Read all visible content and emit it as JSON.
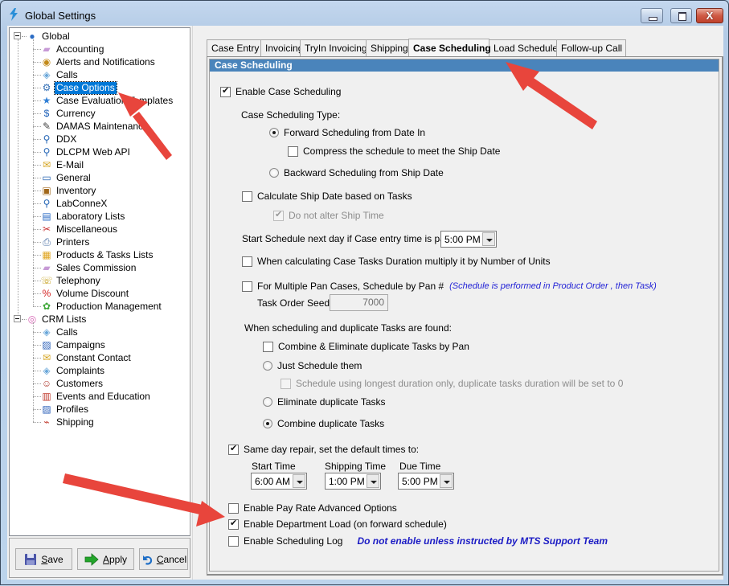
{
  "window": {
    "title": "Global Settings",
    "controls": {
      "minimize": "minimize",
      "maximize": "maximize",
      "close": "X"
    }
  },
  "tree": {
    "groups": [
      {
        "label": "Global",
        "icon": "globe-gear-icon",
        "expanded": true,
        "items": [
          {
            "label": "Accounting",
            "icon": "ticket-icon"
          },
          {
            "label": "Alerts and Notifications",
            "icon": "alarm-clock-icon"
          },
          {
            "label": "Calls",
            "icon": "phone-note-icon"
          },
          {
            "label": "Case Options",
            "icon": "wrench-gear-icon",
            "selected": true
          },
          {
            "label": "Case Evaluation Templates",
            "icon": "star-icon"
          },
          {
            "label": "Currency",
            "icon": "currency-icon"
          },
          {
            "label": "DAMAS Maintenance",
            "icon": "wrench-icon"
          },
          {
            "label": "DDX",
            "icon": "link-icon"
          },
          {
            "label": "DLCPM Web API",
            "icon": "link-icon"
          },
          {
            "label": "E-Mail",
            "icon": "envelope-icon"
          },
          {
            "label": "General",
            "icon": "window-icon"
          },
          {
            "label": "Inventory",
            "icon": "inventory-box-icon"
          },
          {
            "label": "LabConneX",
            "icon": "link-icon"
          },
          {
            "label": "Laboratory Lists",
            "icon": "list-doc-icon"
          },
          {
            "label": "Miscellaneous",
            "icon": "tools-icon"
          },
          {
            "label": "Printers",
            "icon": "printer-icon"
          },
          {
            "label": "Products & Tasks Lists",
            "icon": "blocks-icon"
          },
          {
            "label": "Sales Commission",
            "icon": "ticket-icon"
          },
          {
            "label": "Telephony",
            "icon": "telephone-icon"
          },
          {
            "label": "Volume Discount",
            "icon": "percent-icon"
          },
          {
            "label": "Production Management",
            "icon": "production-icon"
          }
        ]
      },
      {
        "label": "CRM Lists",
        "icon": "disc-icon",
        "expanded": true,
        "items": [
          {
            "label": "Calls",
            "icon": "phone-note-icon"
          },
          {
            "label": "Campaigns",
            "icon": "campaign-icon"
          },
          {
            "label": "Constant Contact",
            "icon": "envelope-icon"
          },
          {
            "label": "Complaints",
            "icon": "phone-note-icon"
          },
          {
            "label": "Customers",
            "icon": "user-icon"
          },
          {
            "label": "Events and Education",
            "icon": "books-icon"
          },
          {
            "label": "Profiles",
            "icon": "campaign-icon"
          },
          {
            "label": "Shipping",
            "icon": "shoe-icon"
          }
        ]
      }
    ]
  },
  "buttons": {
    "save": {
      "label": "Save",
      "mnemonic": "S",
      "rest": "ave"
    },
    "apply": {
      "label": "Apply",
      "mnemonic": "A",
      "rest": "pply"
    },
    "cancel": {
      "label": "Cancel",
      "mnemonic": "C",
      "rest": "ancel"
    }
  },
  "tabs": [
    {
      "label": "Case Entry"
    },
    {
      "label": "Invoicing"
    },
    {
      "label": "TryIn Invoicing"
    },
    {
      "label": "Shipping"
    },
    {
      "label": "Case Scheduling",
      "active": true
    },
    {
      "label": "Load Schedule"
    },
    {
      "label": "Follow-up Call"
    }
  ],
  "page": {
    "section_title": "Case Scheduling",
    "enable_case_scheduling": {
      "label": "Enable Case Scheduling",
      "checked": true
    },
    "scheduling_type_label": "Case Scheduling Type:",
    "forward_scheduling": {
      "label": "Forward Scheduling from Date In",
      "checked": true
    },
    "compress_schedule": {
      "label": "Compress the schedule to meet the Ship Date",
      "checked": false
    },
    "backward_scheduling": {
      "label": "Backward Scheduling from Ship Date",
      "checked": false
    },
    "calc_ship_date": {
      "label": "Calculate Ship Date based on Tasks",
      "checked": false
    },
    "do_not_alter_ship_time": {
      "label": "Do not alter Ship Time",
      "checked": true,
      "disabled": true
    },
    "start_next_day": {
      "label": "Start Schedule next day if Case entry time is past:",
      "value": "5:00 PM"
    },
    "multiply_units": {
      "label": "When calculating Case Tasks Duration multiply it by Number of Units",
      "checked": false
    },
    "multi_pan": {
      "label": "For Multiple Pan Cases, Schedule by Pan #",
      "checked": false,
      "note": "(Schedule is performed in Product Order , then Task)"
    },
    "task_order_seed": {
      "label": "Task Order Seed:",
      "value": "7000"
    },
    "duplicates_label": "When scheduling and duplicate Tasks are found:",
    "combine_eliminate_by_pan": {
      "label": "Combine & Eliminate duplicate Tasks by Pan",
      "checked": false
    },
    "just_schedule": {
      "label": "Just Schedule them",
      "checked": false
    },
    "longest_duration": {
      "label": "Schedule using longest duration only, duplicate tasks duration will be set to 0",
      "checked": false,
      "disabled": true
    },
    "eliminate_duplicates": {
      "label": "Eliminate duplicate Tasks",
      "checked": false
    },
    "combine_duplicates": {
      "label": "Combine duplicate Tasks",
      "checked": true
    },
    "same_day_repair": {
      "label": "Same day repair, set the default times to:",
      "checked": true
    },
    "start_time": {
      "label": "Start Time",
      "value": "6:00 AM"
    },
    "shipping_time": {
      "label": "Shipping Time",
      "value": "1:00 PM"
    },
    "due_time": {
      "label": "Due Time",
      "value": "5:00 PM"
    },
    "pay_rate_advanced": {
      "label": "Enable Pay Rate Advanced Options",
      "checked": false
    },
    "department_load": {
      "label": "Enable Department Load (on forward schedule)",
      "checked": true
    },
    "scheduling_log": {
      "label": "Enable Scheduling Log",
      "checked": false,
      "note": "Do not enable unless instructed by MTS Support Team"
    }
  },
  "colors": {
    "section_header": "#4a84bb",
    "selection": "#0078d7",
    "note_blue": "#2323d6",
    "annotation_arrow": "#e8453c"
  }
}
